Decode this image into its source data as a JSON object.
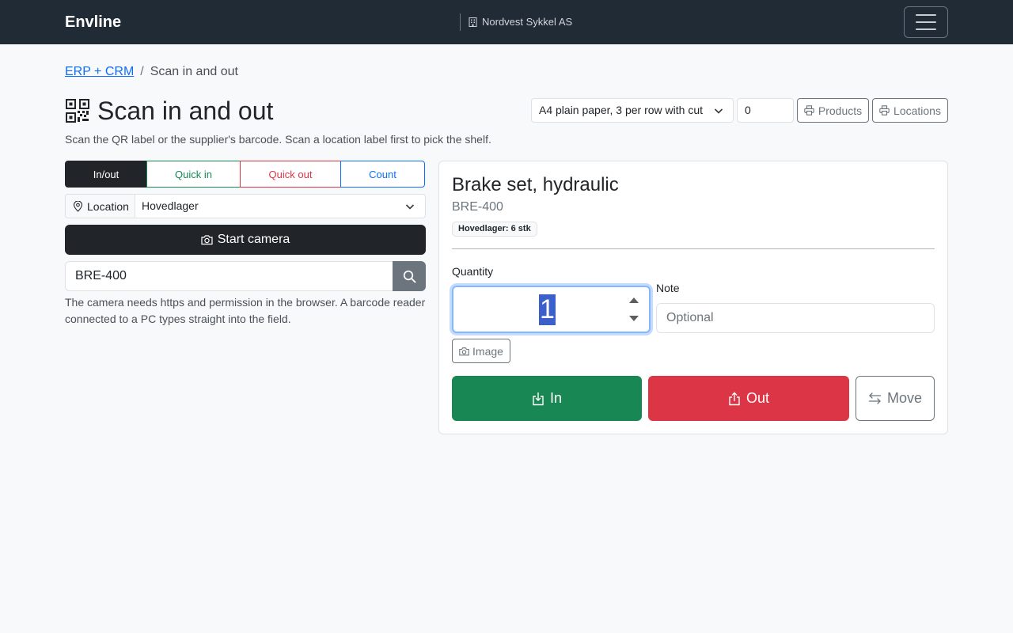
{
  "navbar": {
    "brand": "Envline",
    "company": "Nordvest Sykkel AS"
  },
  "breadcrumb": {
    "parent": "ERP + CRM",
    "separator": "/",
    "current": "Scan in and out"
  },
  "page": {
    "title": "Scan in and out",
    "subtitle": "Scan the QR label or the supplier's barcode. Scan a location label first to pick the shelf."
  },
  "labels_toolbar": {
    "paper_format": "A4 plain paper, 3 per row with cut",
    "count": "0",
    "products_label": "Products",
    "locations_label": "Locations"
  },
  "modes": [
    "In/out",
    "Quick in",
    "Quick out",
    "Count"
  ],
  "active_mode": "In/out",
  "location": {
    "label": "Location",
    "selected": "Hovedlager"
  },
  "camera": {
    "start_label": "Start camera"
  },
  "scan": {
    "value": "BRE-400",
    "help": "The camera needs https and permission in the browser. A barcode reader connected to a PC types straight into the field."
  },
  "product": {
    "name": "Brake set, hydraulic",
    "sku": "BRE-400",
    "stock_badge": "Hovedlager: 6 stk",
    "quantity_label": "Quantity",
    "quantity_value": "1",
    "note_label": "Note",
    "note_placeholder": "Optional",
    "image_label": "Image",
    "in_label": "In",
    "out_label": "Out",
    "move_label": "Move"
  },
  "icons": {
    "company": "building-icon",
    "menu": "hamburger-icon",
    "title": "qr-code-icon",
    "print": "printer-icon",
    "location": "map-pin-icon",
    "camera": "camera-icon",
    "search": "search-icon",
    "in": "box-arrow-in-icon",
    "out": "box-arrow-up-icon",
    "move": "arrows-swap-icon"
  },
  "colors": {
    "navbar": "#212b36",
    "primary": "#0d6efd",
    "success": "#198754",
    "danger": "#dc3545",
    "dark": "#212529",
    "secondary": "#6c757d"
  }
}
